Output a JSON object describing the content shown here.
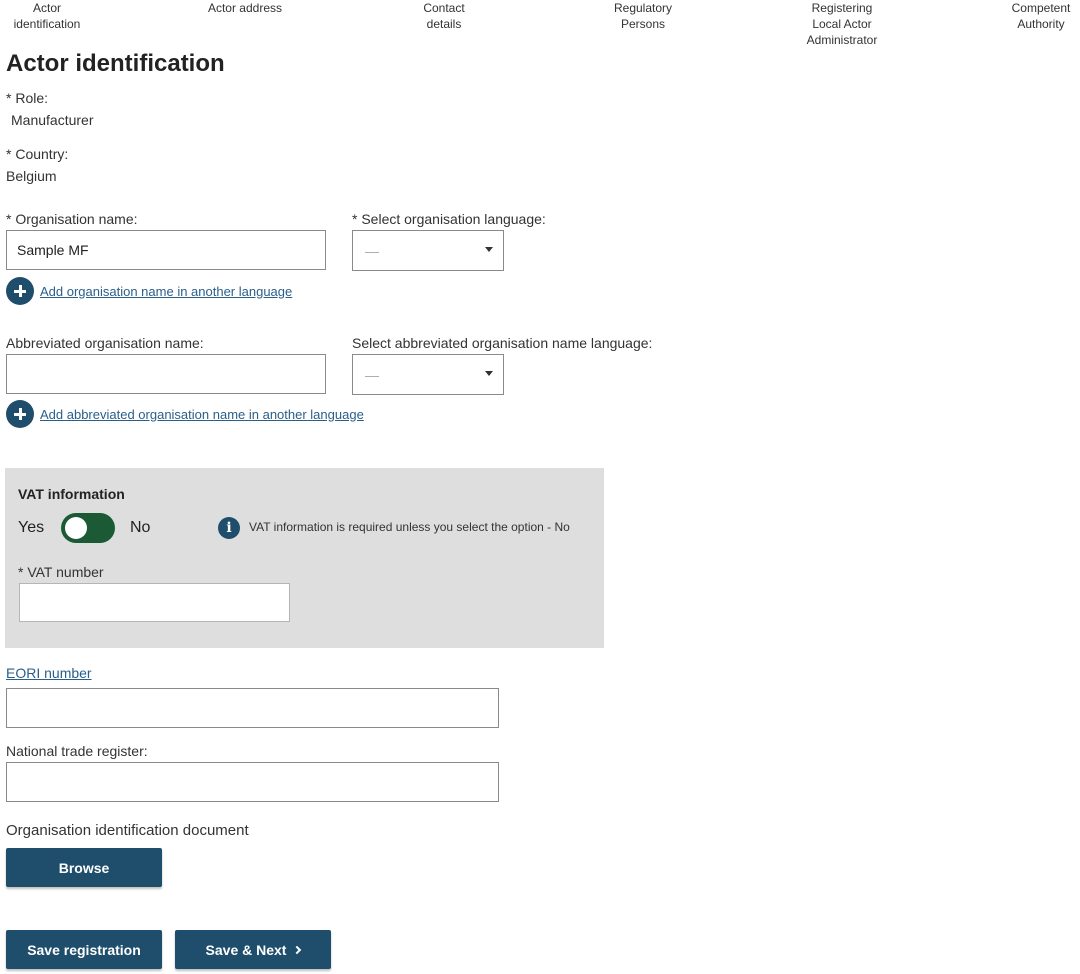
{
  "steps": [
    {
      "label": "Actor\nidentification"
    },
    {
      "label": "Actor address"
    },
    {
      "label": "Contact\ndetails"
    },
    {
      "label": "Regulatory\nPersons"
    },
    {
      "label": "Registering\nLocal Actor\nAdministrator"
    },
    {
      "label": "Competent\nAuthority"
    }
  ],
  "page_title": "Actor identification",
  "role": {
    "label": "* Role:",
    "value": "Manufacturer"
  },
  "country": {
    "label": "* Country:",
    "value": "Belgium"
  },
  "org_name": {
    "label": "* Organisation name:",
    "value": "Sample MF",
    "language_label": "* Select organisation language:",
    "language_value": "—",
    "add_link": "Add organisation name in another language"
  },
  "abbrev_name": {
    "label": "Abbreviated organisation name:",
    "value": "",
    "language_label": "Select abbreviated organisation name language:",
    "language_value": "—",
    "add_link": "Add abbreviated organisation name in another language"
  },
  "vat": {
    "title": "VAT information",
    "yes_label": "Yes",
    "no_label": "No",
    "toggle_state": "Yes",
    "info_icon": "i",
    "info_text": "VAT information is required unless you select the option - No",
    "number_label": "* VAT number",
    "number_value": ""
  },
  "eori": {
    "label": "EORI number",
    "value": ""
  },
  "trade_register": {
    "label": "National trade register:",
    "value": ""
  },
  "org_doc": {
    "label": "Organisation identification document",
    "browse_label": "Browse"
  },
  "actions": {
    "save_label": "Save registration",
    "next_label": "Save & Next"
  },
  "colors": {
    "primary": "#1f4e6c",
    "toggle_on": "#1b5a34",
    "panel_bg": "#dedede",
    "link": "#2a5f8a"
  }
}
